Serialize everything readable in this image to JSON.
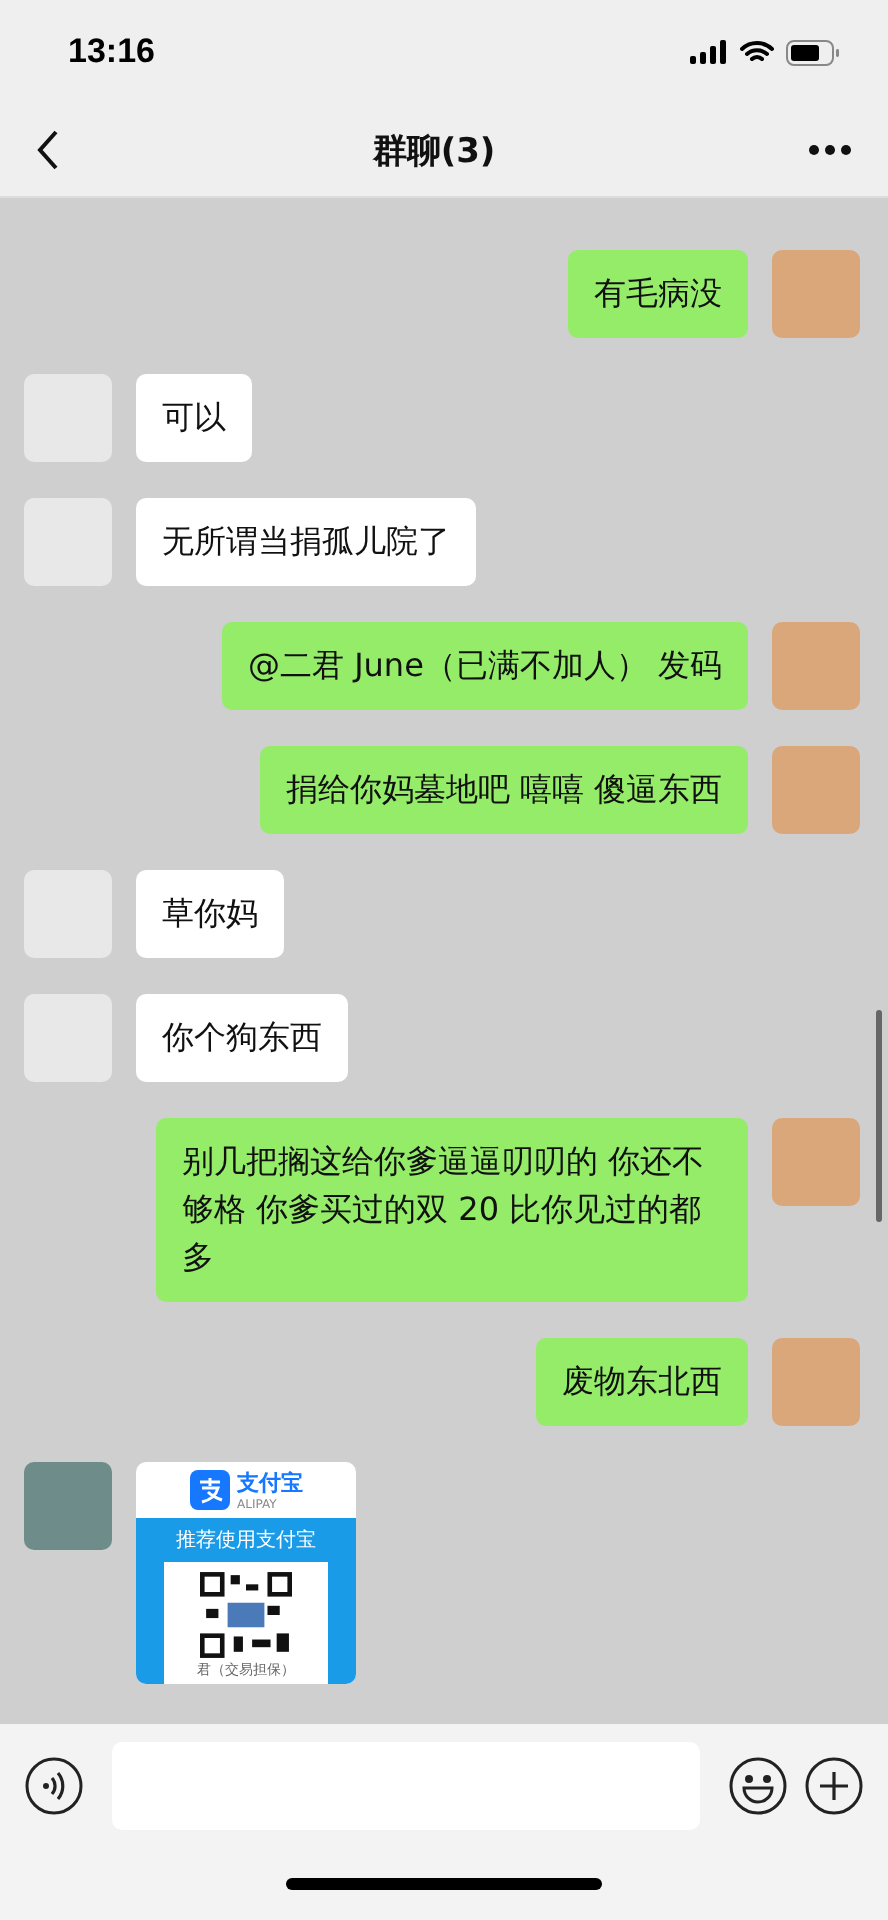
{
  "status_bar": {
    "time": "13:16"
  },
  "header": {
    "title": "群聊(3)"
  },
  "messages": [
    {
      "kind": "text",
      "outgoing": true,
      "text": "有毛病没"
    },
    {
      "kind": "text",
      "outgoing": false,
      "text": "可以"
    },
    {
      "kind": "text",
      "outgoing": false,
      "text": "无所谓当捐孤儿院了"
    },
    {
      "kind": "text",
      "outgoing": true,
      "text": "@二君 June（已满不加人） 发码"
    },
    {
      "kind": "text",
      "outgoing": true,
      "text": "捐给你妈墓地吧 嘻嘻 傻逼东西"
    },
    {
      "kind": "text",
      "outgoing": false,
      "text": "草你妈"
    },
    {
      "kind": "text",
      "outgoing": false,
      "text": "你个狗东西"
    },
    {
      "kind": "text",
      "outgoing": true,
      "text": "别几把搁这给你爹逼逼叨叨的 你还不够格 你爹买过的双 20 比你见过的都多"
    },
    {
      "kind": "text",
      "outgoing": true,
      "text": "废物东北西"
    },
    {
      "kind": "card",
      "outgoing": false,
      "brand": "支付宝",
      "brand_en": "ALIPAY",
      "banner": "推荐使用支付宝",
      "caption": "君（交易担保）"
    }
  ]
}
